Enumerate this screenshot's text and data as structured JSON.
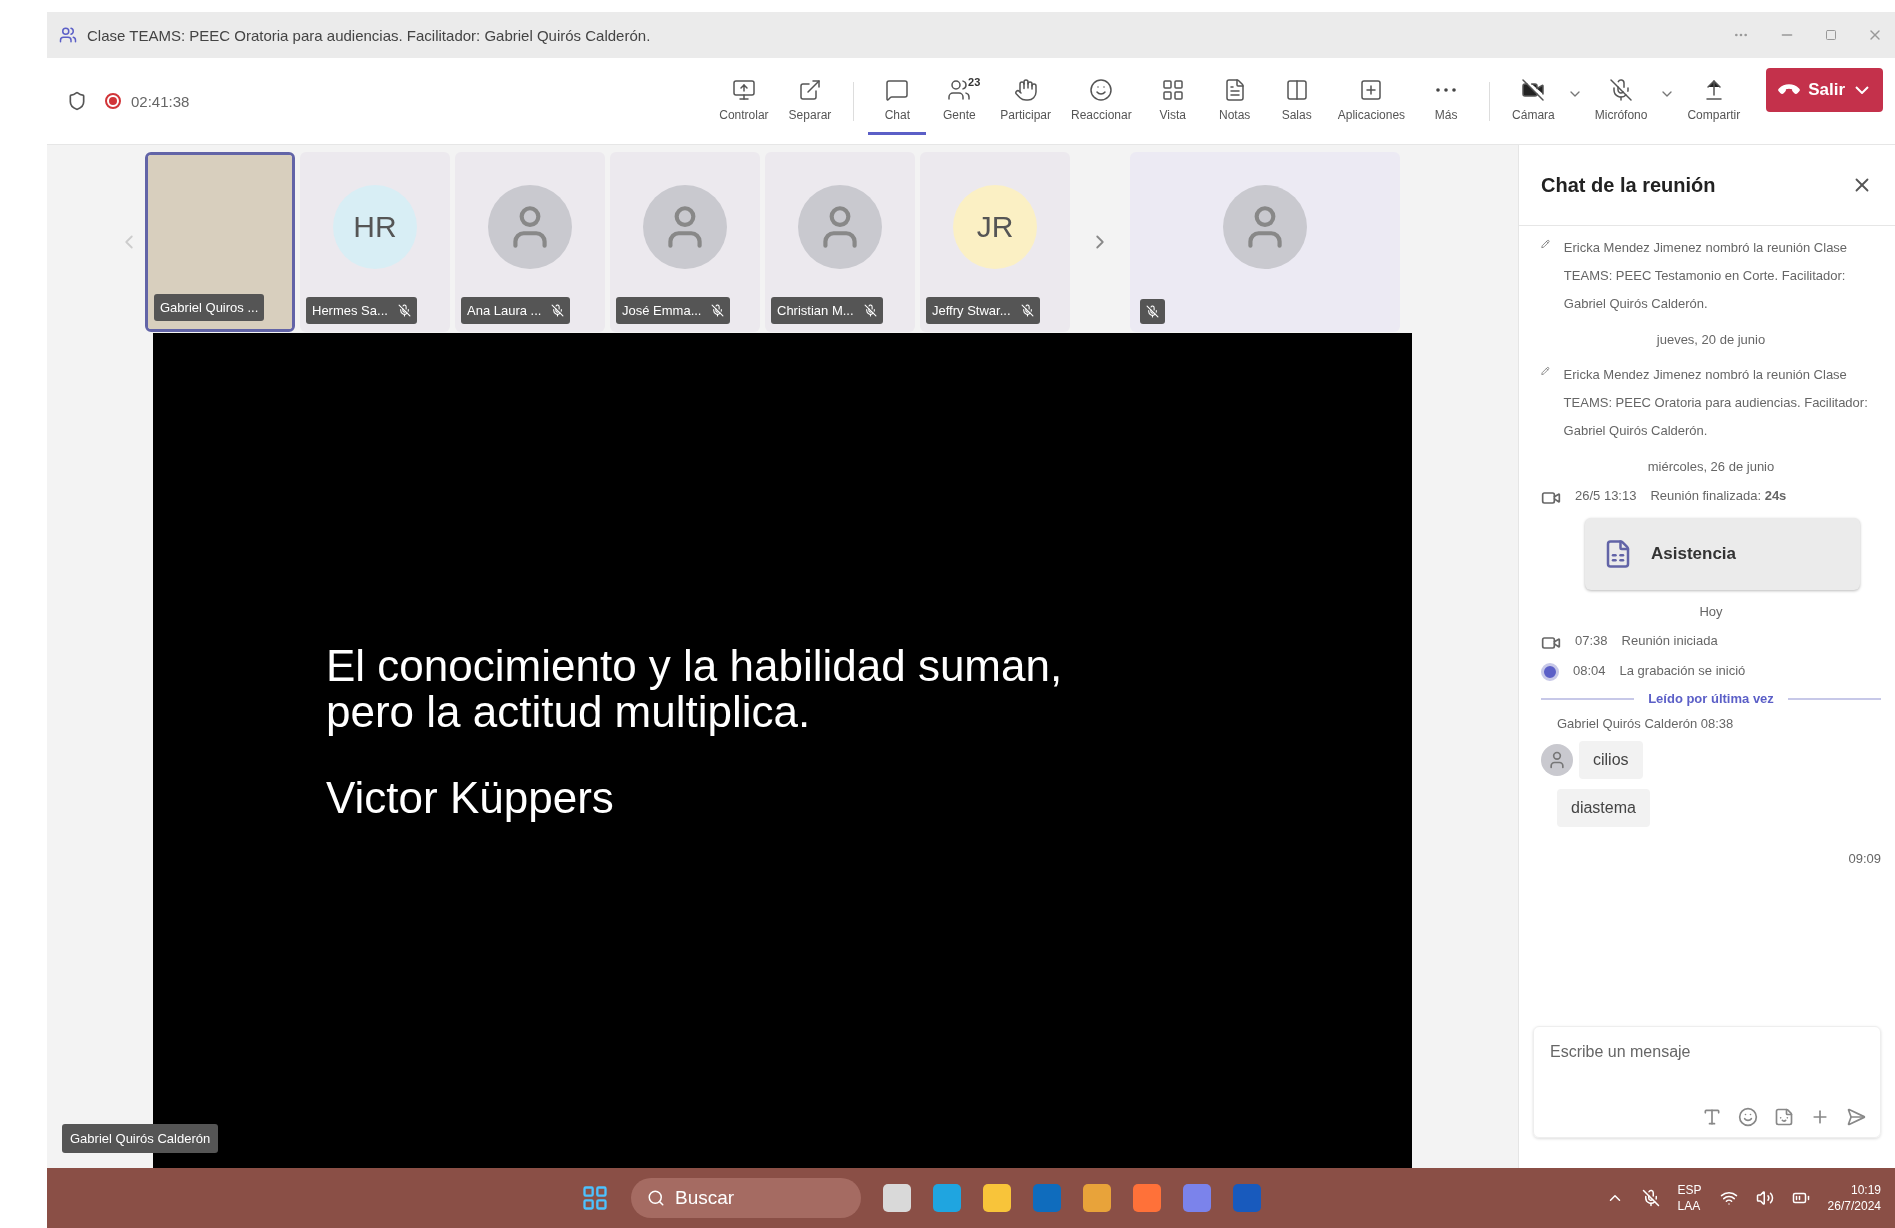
{
  "window": {
    "title": "Clase TEAMS: PEEC Oratoria para audiencias. Facilitador: Gabriel Quirós Calderón."
  },
  "meeting": {
    "timer": "02:41:38",
    "recording": true
  },
  "toolbar": [
    {
      "label": "Controlar",
      "selected": false
    },
    {
      "label": "Separar",
      "selected": false
    },
    {
      "label": "Chat",
      "selected": true
    },
    {
      "label": "Gente",
      "selected": false,
      "badge": "23"
    },
    {
      "label": "Participar",
      "selected": false
    },
    {
      "label": "Reaccionar",
      "selected": false
    },
    {
      "label": "Vista",
      "selected": false
    },
    {
      "label": "Notas",
      "selected": false
    },
    {
      "label": "Salas",
      "selected": false
    },
    {
      "label": "Aplicaciones",
      "selected": false
    },
    {
      "label": "Más",
      "selected": false
    }
  ],
  "devices": [
    {
      "label": "Cámara",
      "off": true
    },
    {
      "label": "Micrófono",
      "off": true
    },
    {
      "label": "Compartir"
    }
  ],
  "leave_button": {
    "label": "Salir"
  },
  "participants": [
    {
      "kind": "video",
      "name": "Gabriel Quiros ...",
      "selected": true,
      "muted": false
    },
    {
      "kind": "initials",
      "name": "Hermes Sa...",
      "initials": "HR",
      "color": "#d8eef5",
      "selected": false,
      "muted": true
    },
    {
      "kind": "photo",
      "name": "Ana Laura ...",
      "selected": false,
      "muted": true
    },
    {
      "kind": "photo",
      "name": "José Emma...",
      "selected": false,
      "muted": true
    },
    {
      "kind": "photo",
      "name": "Christian M...",
      "selected": false,
      "muted": true
    },
    {
      "kind": "initials",
      "name": "Jeffry Stwar...",
      "initials": "JR",
      "color": "#fbf0c4",
      "selected": false,
      "muted": true
    }
  ],
  "overflow_participant": {
    "muted": true
  },
  "slide": {
    "lines": [
      "El conocimiento y la habilidad suman,",
      "pero la actitud multiplica."
    ],
    "author": "Victor Küppers"
  },
  "presenter_tag": "Gabriel Quirós Calderón",
  "chat": {
    "title": "Chat de la reunión",
    "items": [
      {
        "kind": "rename",
        "text": "Ericka Mendez Jimenez nombró la reunión Clase TEAMS: PEEC Testamonio en Corte. Facilitador: Gabriel Quirós Calderón."
      },
      {
        "kind": "date",
        "text": "jueves, 20 de junio"
      },
      {
        "kind": "rename",
        "text": "Ericka Mendez Jimenez nombró la reunión Clase TEAMS: PEEC Oratoria para audiencias. Facilitador: Gabriel Quirós Calderón."
      },
      {
        "kind": "date",
        "text": "miércoles, 26 de junio"
      },
      {
        "kind": "meeting",
        "time": "26/5 13:13",
        "text": "Reunión finalizada: **24s**"
      },
      {
        "kind": "card",
        "text": "**Asistencia**"
      },
      {
        "kind": "date",
        "text": "Hoy"
      },
      {
        "kind": "meeting",
        "time": "07:38",
        "text": "Reunión iniciada"
      },
      {
        "kind": "recording",
        "time": "08:04",
        "text": "La grabación se inició"
      },
      {
        "kind": "divider",
        "text": "**Leído por última vez**"
      },
      {
        "kind": "sender",
        "text": "Gabriel Quirós Calderón   08:38"
      },
      {
        "kind": "message",
        "text": "cilios",
        "avatar": true
      },
      {
        "kind": "message",
        "text": "diastema",
        "avatar": false
      },
      {
        "kind": "time",
        "text": "09:09"
      }
    ],
    "composer": {
      "placeholder": "Escribe un mensaje"
    }
  },
  "taskbar": {
    "search": "Buscar",
    "language": "ESP",
    "layout": "LAA",
    "time": "10:19",
    "date": "26/7/2024"
  }
}
